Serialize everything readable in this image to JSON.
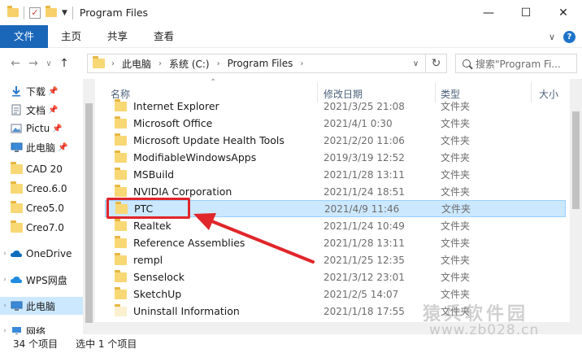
{
  "window": {
    "title": "Program Files",
    "minimize": "—",
    "maximize": "☐",
    "close": "✕"
  },
  "ribbon": {
    "tabs": [
      "文件",
      "主页",
      "共享",
      "查看"
    ],
    "collapse": "∨",
    "help": "?"
  },
  "nav": {
    "back": "←",
    "forward": "→",
    "recent": "∨",
    "up": "↑",
    "breadcrumbs": [
      "此电脑",
      "系统 (C:)",
      "Program Files"
    ],
    "crumb_sep": "›",
    "dropdown": "∨",
    "refresh": "↻",
    "search_placeholder": "搜索\"Program Fi..."
  },
  "sidebar": {
    "items": [
      {
        "label": "下载",
        "icon": "download-icon",
        "pinned": true
      },
      {
        "label": "文档",
        "icon": "document-icon",
        "pinned": true
      },
      {
        "label": "Pictu",
        "icon": "pictures-icon",
        "pinned": true
      },
      {
        "label": "此电脑",
        "icon": "pc-icon",
        "pinned": true
      },
      {
        "label": "CAD 20",
        "icon": "folder-icon",
        "pinned": false
      },
      {
        "label": "Creo.6.0",
        "icon": "folder-icon",
        "pinned": false
      },
      {
        "label": "Creo5.0",
        "icon": "folder-icon",
        "pinned": false
      },
      {
        "label": "Creo7.0",
        "icon": "folder-icon",
        "pinned": false
      },
      {
        "label": "OneDrive",
        "icon": "cloud-icon",
        "pinned": false
      },
      {
        "label": "WPS网盘",
        "icon": "cloud-icon",
        "pinned": false
      },
      {
        "label": "此电脑",
        "icon": "pc-icon",
        "pinned": false
      },
      {
        "label": "网络",
        "icon": "network-icon",
        "pinned": false
      }
    ]
  },
  "columns": {
    "name": "名称",
    "date": "修改日期",
    "type": "类型",
    "size": "大小"
  },
  "files": [
    {
      "name": "Internet Explorer",
      "date": "2021/3/25 21:08",
      "type": "文件夹"
    },
    {
      "name": "Microsoft Office",
      "date": "2021/4/1 0:30",
      "type": "文件夹"
    },
    {
      "name": "Microsoft Update Health Tools",
      "date": "2021/2/20 11:06",
      "type": "文件夹"
    },
    {
      "name": "ModifiableWindowsApps",
      "date": "2019/3/19 12:52",
      "type": "文件夹"
    },
    {
      "name": "MSBuild",
      "date": "2021/1/28 13:11",
      "type": "文件夹"
    },
    {
      "name": "NVIDIA Corporation",
      "date": "2021/1/24 18:51",
      "type": "文件夹"
    },
    {
      "name": "PTC",
      "date": "2021/4/9 11:46",
      "type": "文件夹",
      "selected": true
    },
    {
      "name": "Realtek",
      "date": "2021/1/24 10:49",
      "type": "文件夹"
    },
    {
      "name": "Reference Assemblies",
      "date": "2021/1/28 13:11",
      "type": "文件夹"
    },
    {
      "name": "rempl",
      "date": "2021/1/25 12:35",
      "type": "文件夹"
    },
    {
      "name": "Senselock",
      "date": "2021/3/12 23:01",
      "type": "文件夹"
    },
    {
      "name": "SketchUp",
      "date": "2021/2/5 14:07",
      "type": "文件夹"
    },
    {
      "name": "Uninstall Information",
      "date": "2021/1/18 17:55",
      "type": "文件夹"
    }
  ],
  "status": {
    "count": "34 个项目",
    "selected": "选中 1 个项目"
  },
  "watermark": {
    "line1": "猿兵软件园",
    "line2": "www.zb028.cn"
  },
  "colors": {
    "accent": "#1a66b8",
    "selection": "#cce8ff",
    "highlight": "#e0262b"
  }
}
